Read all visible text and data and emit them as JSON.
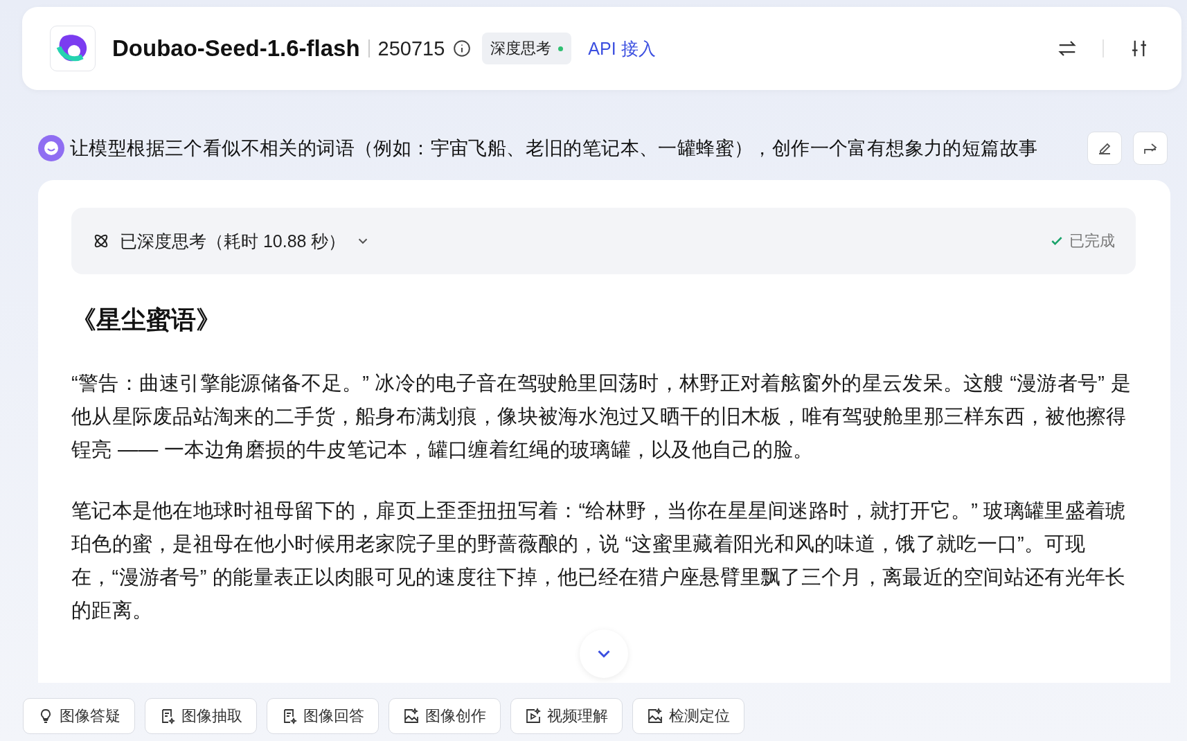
{
  "header": {
    "model_name": "Doubao-Seed-1.6-flash",
    "version": "250715",
    "mode_tag": {
      "label": "深度思考",
      "on": true
    },
    "api_link": "API 接入"
  },
  "prompt": {
    "text": "让模型根据三个看似不相关的词语（例如：宇宙飞船、老旧的笔记本、一罐蜂蜜），创作一个富有想象力的短篇故事"
  },
  "thinking": {
    "label": "已深度思考（耗时 10.88 秒）",
    "expanded": false,
    "status": "已完成"
  },
  "story": {
    "title": "《星尘蜜语》",
    "paragraphs": [
      "“警告：曲速引擎能源储备不足。” 冰冷的电子音在驾驶舱里回荡时，林野正对着舷窗外的星云发呆。这艘 “漫游者号” 是他从星际废品站淘来的二手货，船身布满划痕，像块被海水泡过又晒干的旧木板，唯有驾驶舱里那三样东西，被他擦得锃亮 —— 一本边角磨损的牛皮笔记本，罐口缠着红绳的玻璃罐，以及他自己的脸。",
      "笔记本是他在地球时祖母留下的，扉页上歪歪扭扭写着：“给林野，当你在星星间迷路时，就打开它。” 玻璃罐里盛着琥珀色的蜜，是祖母在他小时候用老家院子里的野蔷薇酿的，说 “这蜜里藏着阳光和风的味道，饿了就吃一口”。可现在，“漫游者号” 的能量表正以肉眼可见的速度往下掉，他已经在猎户座悬臂里飘了三个月，离最近的空间站还有光年长的距离。"
    ]
  },
  "tools": [
    {
      "kind": "bulb",
      "label": "图像答疑"
    },
    {
      "kind": "doc",
      "label": "图像抽取"
    },
    {
      "kind": "doc",
      "label": "图像回答"
    },
    {
      "kind": "image",
      "label": "图像创作"
    },
    {
      "kind": "video",
      "label": "视频理解"
    },
    {
      "kind": "image",
      "label": "检测定位"
    }
  ]
}
